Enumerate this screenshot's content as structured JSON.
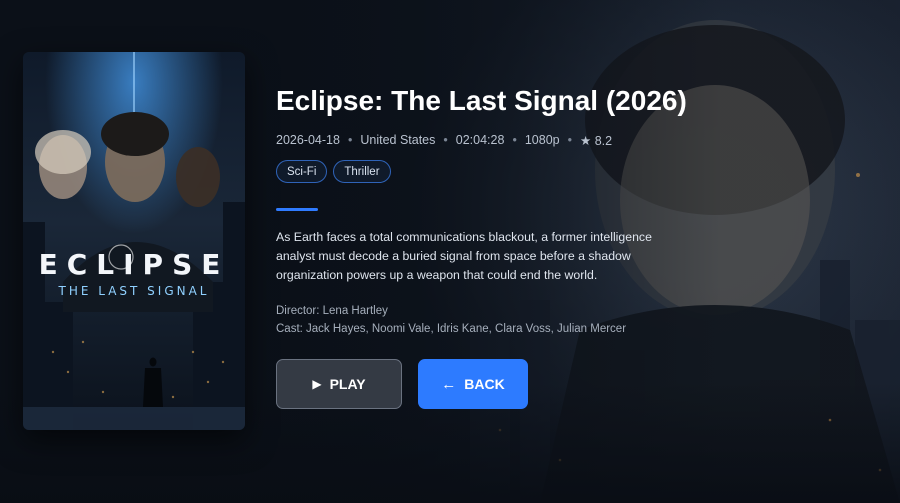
{
  "movie": {
    "title": "Eclipse: The Last Signal (2026)",
    "meta": {
      "date": "2026-04-18",
      "country": "United States",
      "duration": "02:04:28",
      "quality": "1080p",
      "rating": "8.2"
    },
    "genres": [
      "Sci-Fi",
      "Thriller"
    ],
    "description": "As Earth faces a total communications blackout, a former intelligence analyst must decode a buried signal from space before a shadow organization powers up a weapon that could end the world.",
    "director": "Director: Lena Hartley",
    "cast": "Cast: Jack Hayes, Noomi Vale, Idris Kane, Clara Voss, Julian Mercer"
  },
  "poster": {
    "title": "ECLIPSE",
    "subtitle": "THE LAST SIGNAL"
  },
  "buttons": {
    "play_label": "PLAY",
    "back_label": "BACK"
  },
  "icons": {
    "play": "play-icon",
    "back": "arrow-left-icon",
    "rating": "star-icon"
  },
  "colors": {
    "accent": "#2d7bff",
    "tag_border": "#2f63b8",
    "background": "#0b1018"
  }
}
